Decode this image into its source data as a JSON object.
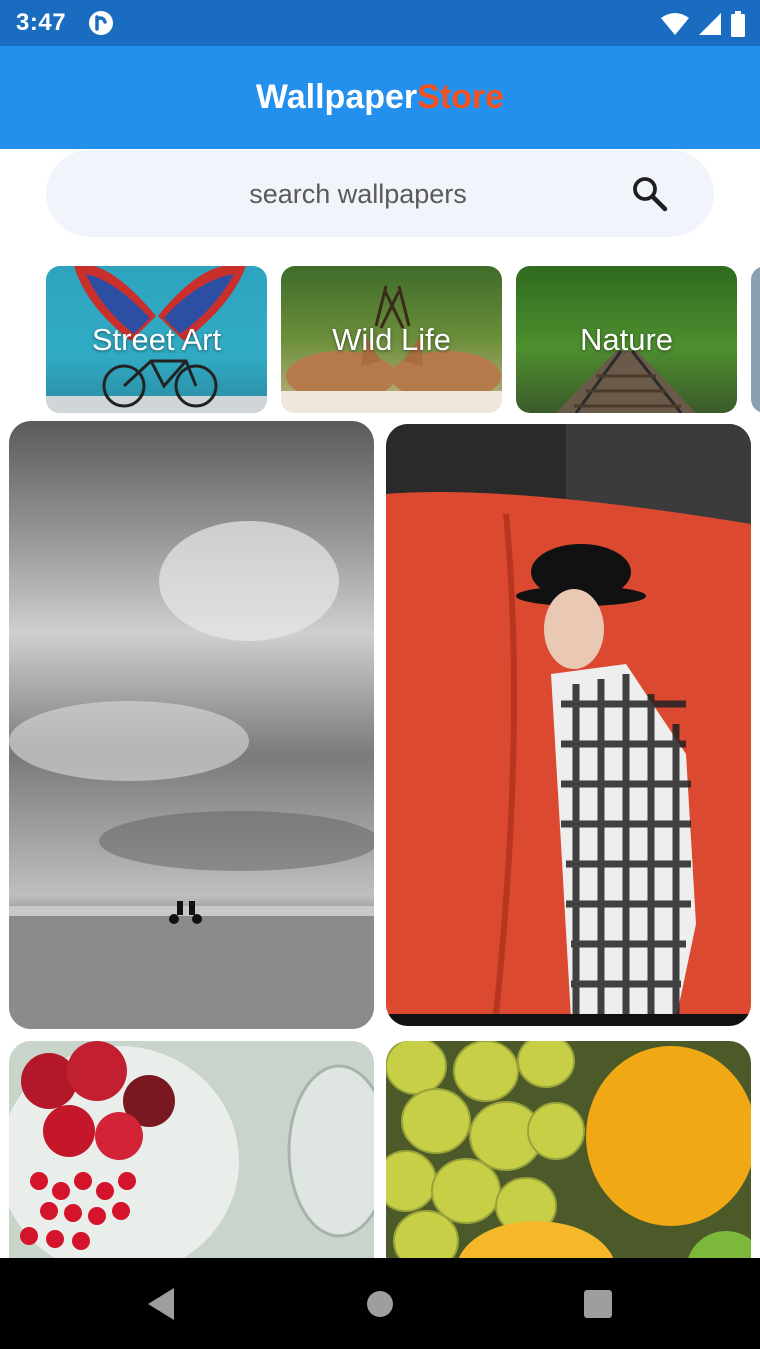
{
  "status_bar": {
    "time": "3:47",
    "icons": [
      "app-badge-icon",
      "wifi-icon",
      "cellular-signal-icon",
      "battery-icon"
    ]
  },
  "app_bar": {
    "title_part1": "Wallpaper",
    "title_part2": "Store",
    "colors": {
      "background": "#2390ed",
      "title_part1": "#ffffff",
      "title_part2": "#f4511e"
    }
  },
  "search": {
    "placeholder": "search wallpapers",
    "value": "",
    "icon": "search-icon"
  },
  "categories": [
    {
      "label": "Street Art"
    },
    {
      "label": "Wild Life"
    },
    {
      "label": "Nature"
    }
  ],
  "wallpapers": [
    {
      "subject": "black and white beach with cyclists"
    },
    {
      "subject": "person with hat in front of red backdrop"
    },
    {
      "subject": "red fruits on plate"
    },
    {
      "subject": "grapes and citrus"
    }
  ],
  "nav_bar": {
    "icons": [
      "back-icon",
      "home-icon",
      "recents-icon"
    ]
  }
}
